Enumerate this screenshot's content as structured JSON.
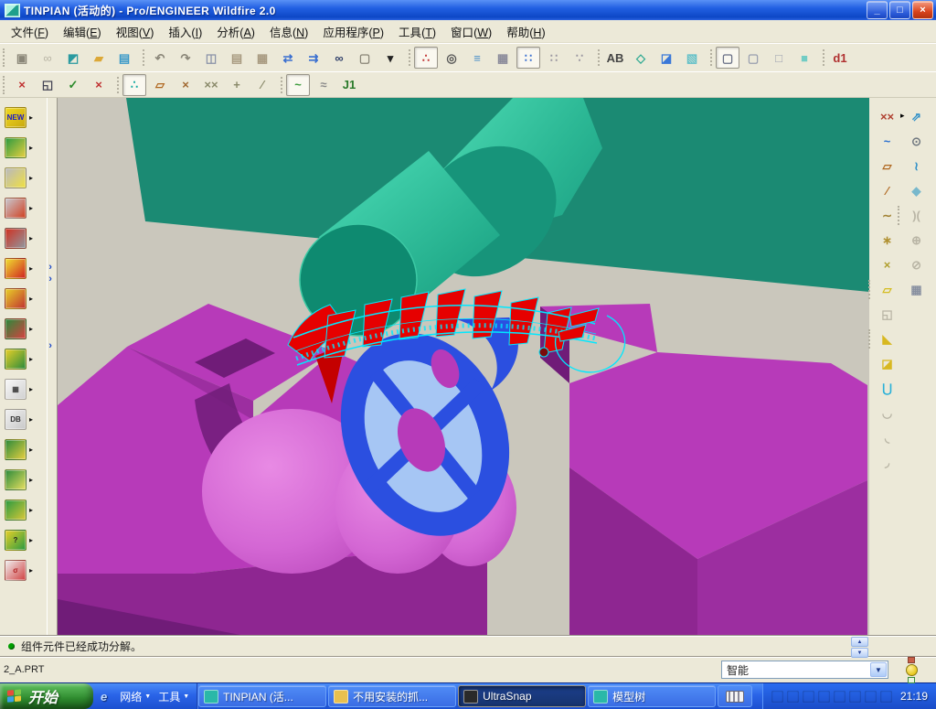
{
  "window": {
    "title": "TINPIAN (活动的) - Pro/ENGINEER Wildfire 2.0",
    "controls": {
      "minimize": "_",
      "restore": "□",
      "close": "×"
    }
  },
  "menu": {
    "items": [
      {
        "name": "menu-file",
        "label": "文件",
        "key": "F"
      },
      {
        "name": "menu-edit",
        "label": "编辑",
        "key": "E"
      },
      {
        "name": "menu-view",
        "label": "视图",
        "key": "V"
      },
      {
        "name": "menu-insert",
        "label": "插入",
        "key": "I"
      },
      {
        "name": "menu-analysis",
        "label": "分析",
        "key": "A"
      },
      {
        "name": "menu-info",
        "label": "信息",
        "key": "N"
      },
      {
        "name": "menu-applications",
        "label": "应用程序",
        "key": "P"
      },
      {
        "name": "menu-tools",
        "label": "工具",
        "key": "T"
      },
      {
        "name": "menu-window",
        "label": "窗口",
        "key": "W"
      },
      {
        "name": "menu-help",
        "label": "帮助",
        "key": "H"
      }
    ]
  },
  "toolbars": {
    "row1": [
      {
        "name": "new-object-icon",
        "glyph": "▣",
        "color": "#8a8678"
      },
      {
        "name": "open-link-icon",
        "glyph": "∞",
        "color": "#8a8678",
        "grayed": true
      },
      {
        "name": "save-as-icon",
        "glyph": "◩",
        "color": "#2a9aa0"
      },
      {
        "name": "open-icon",
        "glyph": "▰",
        "color": "#dca838"
      },
      {
        "name": "save-icon",
        "glyph": "▤",
        "color": "#3898c8"
      },
      {
        "name": "undo-icon",
        "glyph": "↶",
        "color": "#8a8678",
        "gap": true
      },
      {
        "name": "redo-icon",
        "glyph": "↷",
        "color": "#8a8678"
      },
      {
        "name": "copy-icon",
        "glyph": "◫",
        "color": "#8a92a8"
      },
      {
        "name": "paste-icon",
        "glyph": "▤",
        "color": "#a89a80"
      },
      {
        "name": "paste-special-icon",
        "glyph": "▦",
        "color": "#a89a80"
      },
      {
        "name": "update-list-icon",
        "glyph": "⇄",
        "color": "#3a6fd0"
      },
      {
        "name": "update-all-icon",
        "glyph": "⇉",
        "color": "#3a6fd0"
      },
      {
        "name": "find-icon",
        "glyph": "∞",
        "color": "#30406a"
      },
      {
        "name": "select-box-icon",
        "glyph": "▢",
        "color": "#8a8678"
      },
      {
        "name": "select-menu-arrow-icon",
        "glyph": "▾",
        "color": "#222"
      },
      {
        "name": "datum-refit-icon",
        "glyph": "∴",
        "color": "#c03030",
        "gap": true,
        "pressed": true
      },
      {
        "name": "zoom-selected-icon",
        "glyph": "◎",
        "color": "#555"
      },
      {
        "name": "layers-icon",
        "glyph": "≡",
        "color": "#4a90c8"
      },
      {
        "name": "view-manager-icon",
        "glyph": "▦",
        "color": "#8a8a9a"
      },
      {
        "name": "tree-columns-icon",
        "glyph": "∷",
        "color": "#3a6fd0",
        "pressed": true
      },
      {
        "name": "tree-filter-icon",
        "glyph": "∷",
        "color": "#9a96a0"
      },
      {
        "name": "tree-sort-icon",
        "glyph": "∵",
        "color": "#9a96a0"
      },
      {
        "name": "annotation-icon",
        "glyph": "AB",
        "color": "#444",
        "gap": true
      },
      {
        "name": "publish-datum-icon",
        "glyph": "◇",
        "color": "#2aa890"
      },
      {
        "name": "shaded-window-icon",
        "glyph": "◪",
        "color": "#3a78d8"
      },
      {
        "name": "light-cube-icon",
        "glyph": "▧",
        "color": "#62c0c8"
      },
      {
        "name": "wireframe-icon",
        "glyph": "▢",
        "color": "#6a7086",
        "gap": true,
        "pressed": true
      },
      {
        "name": "hidden-line-icon",
        "glyph": "▢",
        "color": "#9aa0b0"
      },
      {
        "name": "no-hidden-icon",
        "glyph": "□",
        "color": "#9aa0b0"
      },
      {
        "name": "shaded-icon",
        "glyph": "■",
        "color": "#72ccc4"
      },
      {
        "name": "dimension-info-icon",
        "glyph": "d1",
        "color": "#b03030",
        "gap": true
      }
    ],
    "row2": [
      {
        "name": "close-window-icon",
        "glyph": "×",
        "color": "#c03030"
      },
      {
        "name": "new-window-icon",
        "glyph": "◱",
        "color": "#445"
      },
      {
        "name": "activate-window-icon",
        "glyph": "✓",
        "color": "#2a8a2a"
      },
      {
        "name": "close-window2-icon",
        "glyph": "×",
        "color": "#c03030"
      },
      {
        "name": "datum-tree-icon",
        "glyph": "∴",
        "color": "#10a8a0",
        "gap": true,
        "pressed": true
      },
      {
        "name": "plane-display-icon",
        "glyph": "▱",
        "color": "#b06820"
      },
      {
        "name": "axis-display-icon",
        "glyph": "×",
        "color": "#a06830"
      },
      {
        "name": "point-display-icon",
        "glyph": "××",
        "color": "#8a8a6a"
      },
      {
        "name": "csys-display-icon",
        "glyph": "+",
        "color": "#8a8a6a"
      },
      {
        "name": "line-display-icon",
        "glyph": "∕",
        "color": "#8a8a6a"
      },
      {
        "name": "spline-icon",
        "glyph": "~",
        "color": "#3a9a3a",
        "gap": true,
        "pressed": true
      },
      {
        "name": "sweep-pipe-icon",
        "glyph": "≈",
        "color": "#8a8a8a"
      },
      {
        "name": "j1-connection-icon",
        "glyph": "J1",
        "color": "#2a7a2a"
      }
    ]
  },
  "sidebar": {
    "items": [
      {
        "name": "emx-new-project-icon",
        "label": "NEW",
        "c1": "#f0d820",
        "c2": "#c8a810",
        "tc": "#1a1acc"
      },
      {
        "name": "emx-moldbase-icon",
        "label": "",
        "c1": "#2a9a40",
        "c2": "#e8d040"
      },
      {
        "name": "emx-component-icon",
        "label": "",
        "c1": "#b8b8c0",
        "c2": "#f0e040"
      },
      {
        "name": "emx-cutout-icon",
        "label": "",
        "c1": "#c8c8d0",
        "c2": "#d04020"
      },
      {
        "name": "emx-screw-icon",
        "label": "",
        "c1": "#d03020",
        "c2": "#9098a0"
      },
      {
        "name": "emx-pen-icon",
        "label": "",
        "c1": "#f0e030",
        "c2": "#d02020"
      },
      {
        "name": "emx-pen2-icon",
        "label": "",
        "c1": "#e8d028",
        "c2": "#c03030"
      },
      {
        "name": "emx-slider-icon",
        "label": "",
        "c1": "#2a8a3a",
        "c2": "#d84040"
      },
      {
        "name": "emx-lifter-icon",
        "label": "",
        "c1": "#e8d028",
        "c2": "#2a8a3a"
      },
      {
        "name": "emx-bom-table-icon",
        "label": "▦",
        "c1": "#f8f8f8",
        "c2": "#d0d0d0",
        "tc": "#444"
      },
      {
        "name": "emx-db-export-icon",
        "label": "DB",
        "c1": "#f0f0f0",
        "c2": "#c8c8c8",
        "tc": "#333"
      },
      {
        "name": "emx-analysis-icon",
        "label": "",
        "c1": "#2a8a3a",
        "c2": "#e8d040"
      },
      {
        "name": "emx-trim-icon",
        "label": "",
        "c1": "#2a8a3a",
        "c2": "#e8e060"
      },
      {
        "name": "emx-rack-icon",
        "label": "",
        "c1": "#2a9a40",
        "c2": "#d8c838"
      },
      {
        "name": "emx-check-icon",
        "label": "?",
        "c1": "#e8d028",
        "c2": "#2a9a40",
        "tc": "#202020"
      },
      {
        "name": "emx-dimension-icon",
        "label": "σ",
        "c1": "#f0f0f0",
        "c2": "#d04040",
        "tc": "#b02020"
      }
    ],
    "flyout_glyph": "▸"
  },
  "right_toolbar": {
    "flyout_glyph": "▸",
    "datum_col": [
      {
        "name": "datum-point-icon",
        "glyph": "××",
        "color": "#b04030"
      },
      {
        "name": "curve-thru-points-icon",
        "glyph": "~",
        "color": "#2a6fd0"
      },
      {
        "name": "datum-plane-icon",
        "glyph": "▱",
        "color": "#b06820"
      },
      {
        "name": "datum-axis-icon",
        "glyph": "∕",
        "color": "#b06820"
      },
      {
        "name": "insert-curve-icon",
        "glyph": "∼",
        "color": "#a08030"
      },
      {
        "name": "coordinate-system-icon",
        "glyph": "∗",
        "color": "#b09030"
      },
      {
        "name": "offset-point-icon",
        "glyph": "×",
        "color": "#b0a030"
      },
      {
        "name": "sketch-tool-icon",
        "glyph": "▱",
        "color": "#d4bc20",
        "gap": true
      },
      {
        "name": "use-previous-icon",
        "glyph": "◱",
        "color": "#999",
        "grayed": true
      },
      {
        "name": "mold-volume-icon",
        "glyph": "◣",
        "color": "#d8b820",
        "gap": true
      },
      {
        "name": "mold-component-icon",
        "glyph": "◪",
        "color": "#d8b820"
      },
      {
        "name": "mold-opening-icon",
        "glyph": "⋃",
        "color": "#28b0d8"
      },
      {
        "name": "silhouette-curve-icon",
        "glyph": "◡",
        "color": "#999",
        "grayed": true
      },
      {
        "name": "skirt-surface-icon",
        "glyph": "◟",
        "color": "#999",
        "grayed": true
      },
      {
        "name": "shutoff-surface-icon",
        "glyph": "◞",
        "color": "#999",
        "grayed": true
      }
    ],
    "feature_col": [
      {
        "name": "extrude-icon",
        "glyph": "⇗",
        "color": "#3090c8"
      },
      {
        "name": "revolve-icon",
        "glyph": "⊙",
        "color": "#707880"
      },
      {
        "name": "sweep-icon",
        "glyph": "≀",
        "color": "#3090c8"
      },
      {
        "name": "boundary-blend-icon",
        "glyph": "◆",
        "color": "#78b8cc"
      },
      {
        "name": "mirror-icon",
        "glyph": ")(",
        "color": "#999",
        "grayed": true,
        "gap": true
      },
      {
        "name": "merge-icon",
        "glyph": "⊕",
        "color": "#999",
        "grayed": true
      },
      {
        "name": "intersect-icon",
        "glyph": "⊘",
        "color": "#999",
        "grayed": true
      },
      {
        "name": "pattern-icon",
        "glyph": "▦",
        "color": "#8890a0"
      }
    ]
  },
  "viewport": {
    "colors": {
      "bg3d": "#cac7bc",
      "plate": "#1b8a73",
      "cylface": "#0e8a70",
      "blocktop": "#b73ab9",
      "blockside": "#9c2ea0",
      "blockfront": "#8e2691",
      "blockdark": "#701c78",
      "blue": "#2b4fe0",
      "bluelight": "#a6c6f4",
      "red": "#e60000",
      "cyan": "#00e8ff"
    },
    "parts": [
      "mold-plate",
      "core-cylinder",
      "cavity-block-left",
      "cavity-block-right",
      "impeller-part",
      "insert-comb"
    ]
  },
  "statusbar": {
    "message": "组件元件已经成功分解。",
    "scroll_up": "▲",
    "scroll_down": "▼"
  },
  "modelbar": {
    "model": "2_A.PRT",
    "filter_value": "智能",
    "combo_arrow": "▼"
  },
  "sash": {
    "chevron": "›"
  },
  "taskbar": {
    "start_label": "开始",
    "quick": [
      {
        "name": "ie-launcher",
        "glyph": "e",
        "color": "#bcd8ff",
        "label": "",
        "caret": ""
      },
      {
        "name": "network-menu",
        "glyph": "",
        "label": "网络",
        "caret": "▼"
      },
      {
        "name": "tools-menu",
        "glyph": "",
        "label": "工具",
        "caret": "▼"
      }
    ],
    "tasks": [
      {
        "name": "task-tinpian",
        "label": "TINPIAN (活...",
        "ic": "#2ab8a8"
      },
      {
        "name": "task-folder",
        "label": "不用安装的抓...",
        "ic": "#e8c050"
      },
      {
        "name": "task-ultrasnap",
        "label": "UltraSnap",
        "ic": "#2a2a2a",
        "pressed": true
      },
      {
        "name": "task-modeltree",
        "label": "模型树",
        "ic": "#2ab8a8"
      }
    ],
    "tray": [
      {
        "name": "tray-camera-icon",
        "ic": "#3a3a3a"
      },
      {
        "name": "tray-battery-icon",
        "ic": "#2244bb"
      },
      {
        "name": "tray-offline-icon",
        "ic": "#99aadd"
      },
      {
        "name": "tray-car-icon",
        "ic": "#bb2222"
      },
      {
        "name": "tray-card-icon",
        "ic": "#44a044"
      },
      {
        "name": "tray-volume-icon",
        "ic": "#c8a030"
      },
      {
        "name": "tray-usb-icon",
        "ic": "#8aa8c8"
      },
      {
        "name": "tray-shield-icon",
        "ic": "#2a9a2a"
      }
    ],
    "clock": "21:19"
  }
}
